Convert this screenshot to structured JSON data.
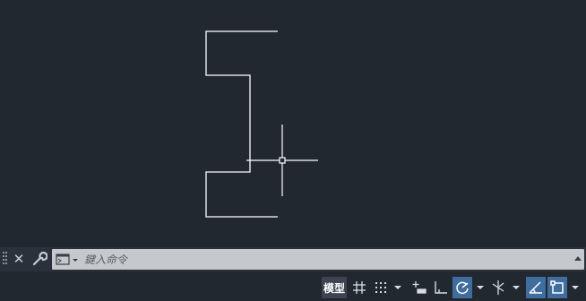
{
  "command_line": {
    "placeholder": "鍵入命令",
    "value": ""
  },
  "status_bar": {
    "model_tab_label": "模型",
    "tools": [
      {
        "name": "grid-display",
        "active": false
      },
      {
        "name": "snap-mode",
        "active": false
      },
      {
        "name": "infer-constraints",
        "active": false
      },
      {
        "name": "ortho-mode",
        "active": false
      },
      {
        "name": "polar-tracking",
        "active": true
      },
      {
        "name": "isometric-drafting",
        "active": false
      },
      {
        "name": "object-snap-tracking",
        "active": true
      },
      {
        "name": "object-snap",
        "active": true
      }
    ]
  },
  "colors": {
    "canvas_background": "#212830",
    "drawing_lines": "#ffffff",
    "active_toggle": "#3f6d9e",
    "command_box": "#c5c8cc"
  },
  "icons": [
    "grip-icon",
    "close-icon",
    "wrench-icon",
    "command-prompt-icon",
    "history-arrow-icon",
    "grid-icon",
    "snap-icon",
    "dropdown-arrow-icon",
    "infer-constraints-icon",
    "ortho-icon",
    "polar-tracking-icon",
    "isometric-icon",
    "object-snap-tracking-icon",
    "object-snap-icon",
    "crosshair-cursor-icon"
  ]
}
